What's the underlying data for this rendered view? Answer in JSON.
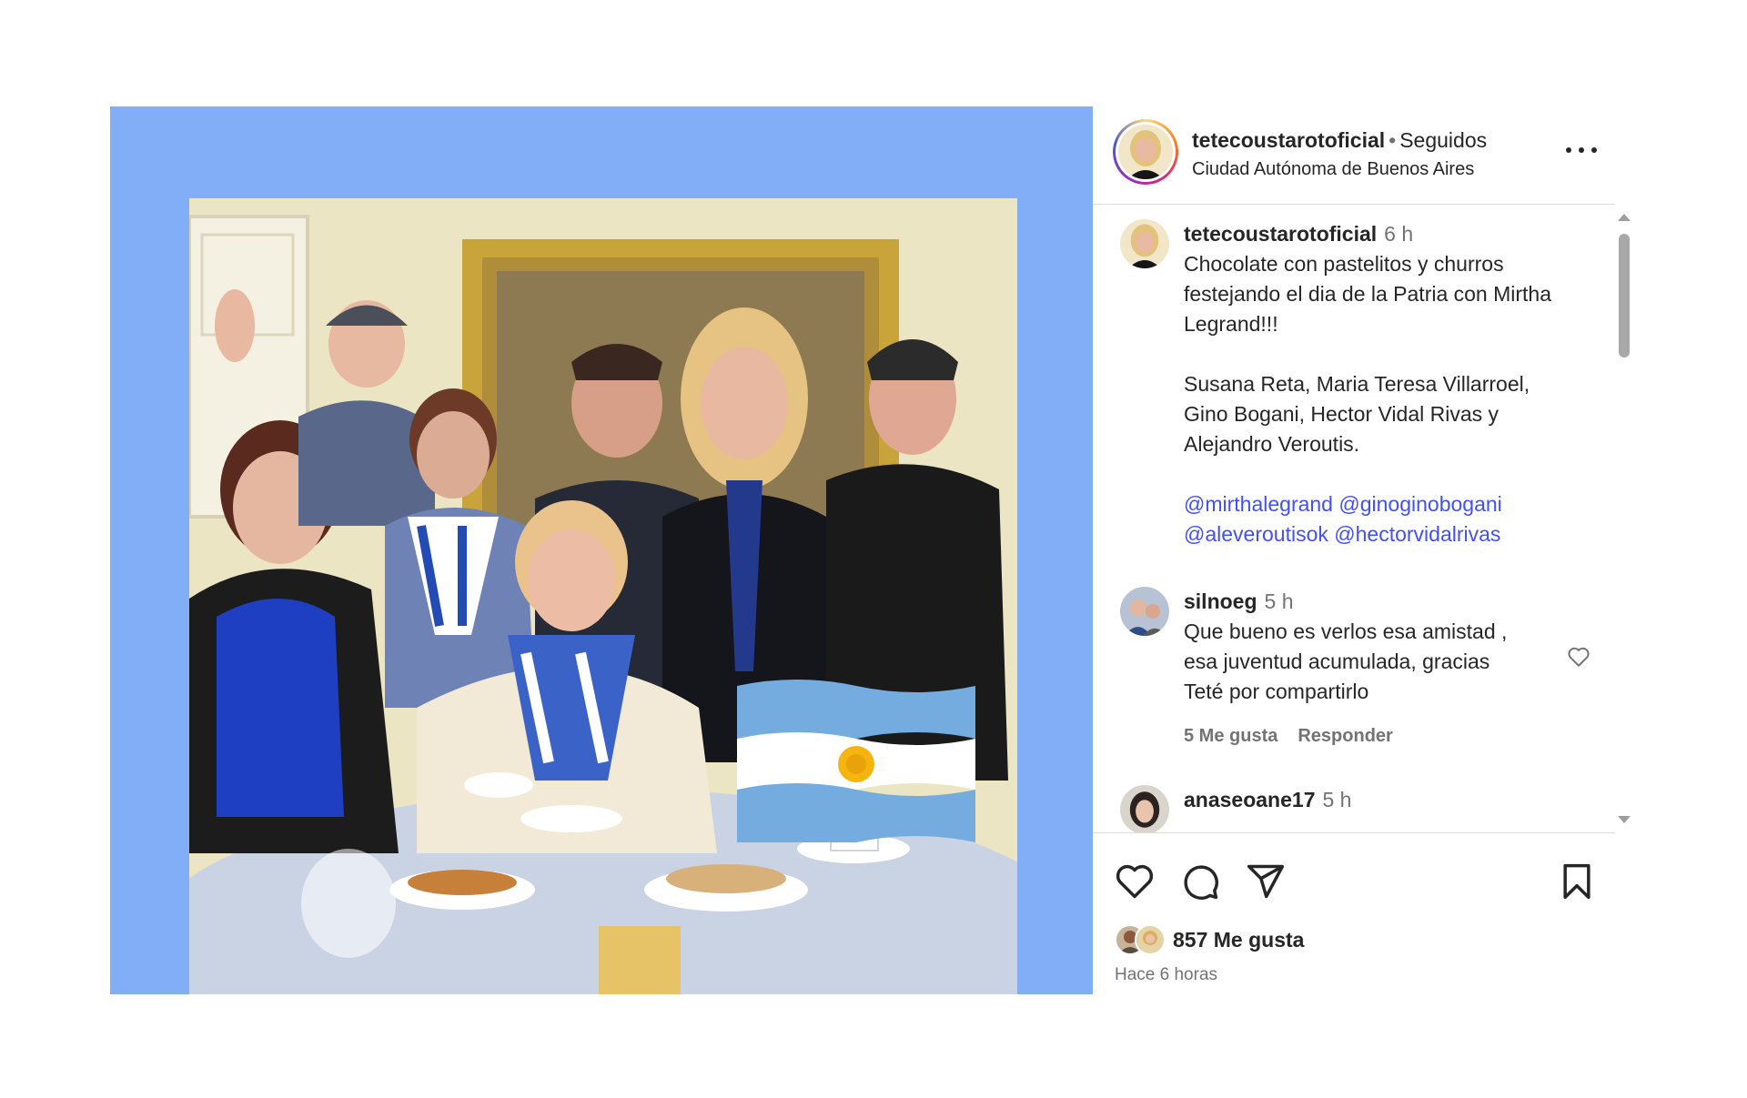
{
  "header": {
    "username": "tetecoustarotoficial",
    "separator": "•",
    "follow_status": "Seguidos",
    "location": "Ciudad Autónoma de Buenos Aires",
    "more_icon": "more-horizontal-icon"
  },
  "caption": {
    "username": "tetecoustarotoficial",
    "time": "6 h",
    "lines": [
      "Chocolate con pastelitos y churros",
      "festejando el dia de la Patria con Mirtha",
      "Legrand!!!"
    ],
    "names_lines": [
      "Susana Reta, Maria Teresa Villarroel,",
      "Gino Bogani, Hector Vidal Rivas y",
      "Alejandro Veroutis."
    ],
    "mentions": [
      [
        "@mirthalegrand",
        "@ginoginobogani"
      ],
      [
        "@aleveroutisok",
        "@hectorvidalrivas"
      ]
    ]
  },
  "comments": [
    {
      "username": "silnoeg",
      "time": "5 h",
      "lines": [
        "Que bueno es verlos esa amistad ,",
        "esa juventud acumulada, gracias",
        "Teté por compartirlo"
      ],
      "likes": "5 Me gusta",
      "reply": "Responder"
    },
    {
      "username": "anaseoane17",
      "time": "5 h"
    }
  ],
  "actions": {
    "icons": [
      "heart-icon",
      "comment-icon",
      "share-icon",
      "bookmark-icon"
    ],
    "likes_count": "857 Me gusta",
    "posted_ago": "Hace 6 horas"
  },
  "colors": {
    "media_background": "#82aef7",
    "mention": "#4150f7",
    "flag_blue": "#74acdf",
    "secondary_text": "#737373"
  }
}
